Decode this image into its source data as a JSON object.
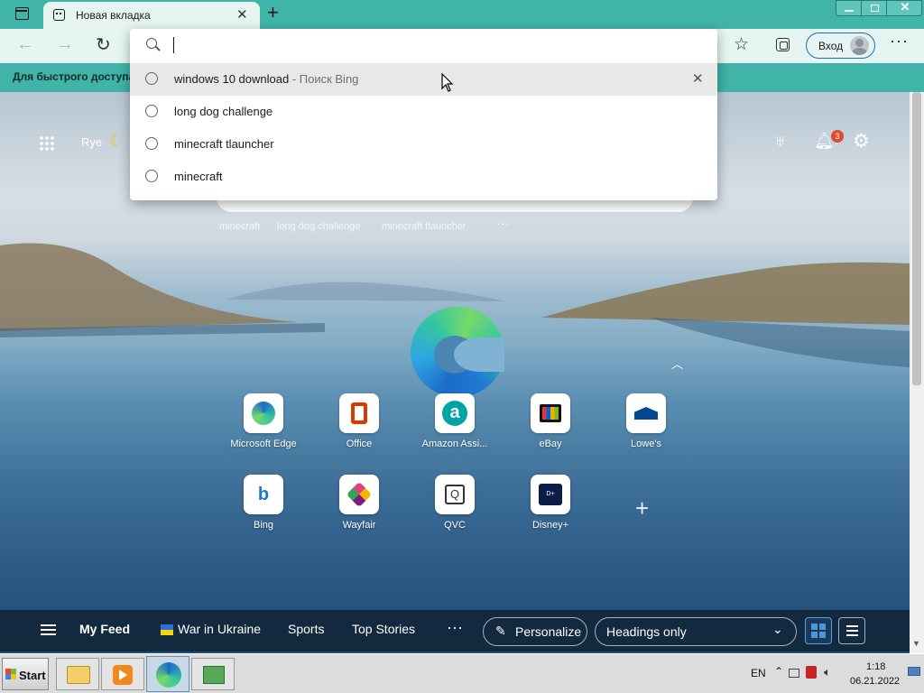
{
  "browser": {
    "tab_title": "Новая вкладка",
    "favorites_bar_text": "Для быстрого доступа",
    "sign_in_label": "Вход",
    "address_value": ""
  },
  "suggestions": [
    {
      "text": "windows 10 download",
      "suffix": " - Поиск Bing",
      "highlighted": true
    },
    {
      "text": "long dog challenge",
      "suffix": ""
    },
    {
      "text": "minecraft tlauncher",
      "suffix": ""
    },
    {
      "text": "minecraft",
      "suffix": ""
    }
  ],
  "newtab": {
    "weather_location": "Rye",
    "notification_count": "3",
    "recent_searches": [
      "minecraft",
      "long dog challenge",
      "minecraft tlauncher"
    ],
    "quicklinks": [
      {
        "label": "Microsoft Edge",
        "icon": "edge-icon"
      },
      {
        "label": "Office",
        "icon": "office-icon"
      },
      {
        "label": "Amazon Assi...",
        "icon": "amazon-icon"
      },
      {
        "label": "eBay",
        "icon": "ebay-icon"
      },
      {
        "label": "Lowe's",
        "icon": "lowes-icon"
      },
      {
        "label": "Bing",
        "icon": "bing-icon"
      },
      {
        "label": "Wayfair",
        "icon": "wayfair-icon"
      },
      {
        "label": "QVC",
        "icon": "qvc-icon"
      },
      {
        "label": "Disney+",
        "icon": "disney-icon"
      }
    ]
  },
  "feed": {
    "my_feed": "My Feed",
    "items": [
      "War in Ukraine",
      "Sports",
      "Top Stories"
    ],
    "personalize": "Personalize",
    "layout_select": "Headings only"
  },
  "taskbar": {
    "start_label": "Start",
    "language": "EN",
    "time": "1:18",
    "date": "06.21.2022"
  },
  "colors": {
    "accent": "#40b4a8",
    "toolbar": "#e6f5f2",
    "notification_badge": "#e04a2f"
  }
}
